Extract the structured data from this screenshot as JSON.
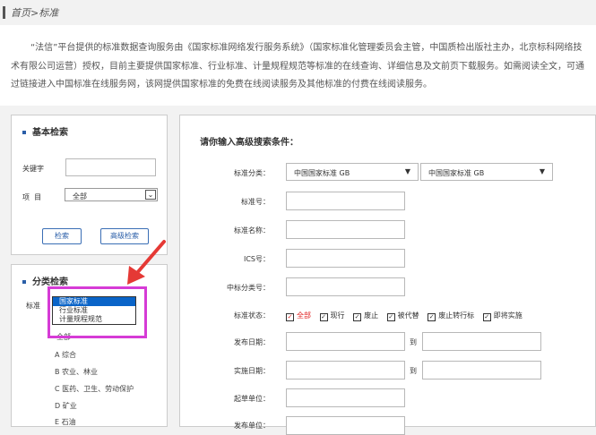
{
  "breadcrumb": "首页>标准",
  "intro": "“法信”平台提供的标准数据查询服务由《国家标准网络发行服务系统》（国家标准化管理委员会主管，中国质检出版社主办，北京标科网络技术有限公司运营）授权，目前主要提供国家标准、行业标准、计量规程规范等标准的在线查询、详细信息及文前页下载服务。如需阅读全文，可通过链接进入中国标准在线服务网，该网提供国家标准的免费在线阅读服务及其他标准的付费在线阅读服务。",
  "basic_search": {
    "title": "基本检索",
    "keyword_label": "关键字",
    "item_label": "项  目",
    "item_value": "全部",
    "search_button": "检索",
    "advanced_button": "高级检索"
  },
  "category_search": {
    "title": "分类检索",
    "standard_label": "标准",
    "dropdown_options": [
      "国家标准",
      "行业标准",
      "计量规程规范"
    ],
    "dropdown_selected": "国家标准",
    "all_label": "全部",
    "categories": [
      "A 综合",
      "B 农业、林业",
      "C 医药、卫生、劳动保护",
      "D 矿业",
      "E 石油"
    ]
  },
  "advanced_form": {
    "heading": "请你输入高级搜索条件：",
    "category_label": "标准分类：",
    "category_select_1": "中国国家标准 GB",
    "category_select_2": "中国国家标准 GB",
    "number_label": "标准号：",
    "name_label": "标准名称：",
    "ics_label": "ICS号：",
    "ccs_label": "中标分类号：",
    "status_label": "标准状态：",
    "status_options": [
      "全部",
      "现行",
      "废止",
      "被代替",
      "废止转行标",
      "即将实施"
    ],
    "publish_date_label": "发布日期：",
    "implement_date_label": "实施日期：",
    "to_label": "到",
    "drafting_unit_label": "起草单位：",
    "publisher_label": "发布单位："
  },
  "colors": {
    "accent": "#2a5ea8",
    "highlight": "#d63bd6",
    "arrow": "#e53935",
    "selected_option": "#0a64c8",
    "status_all": "#e02020"
  }
}
